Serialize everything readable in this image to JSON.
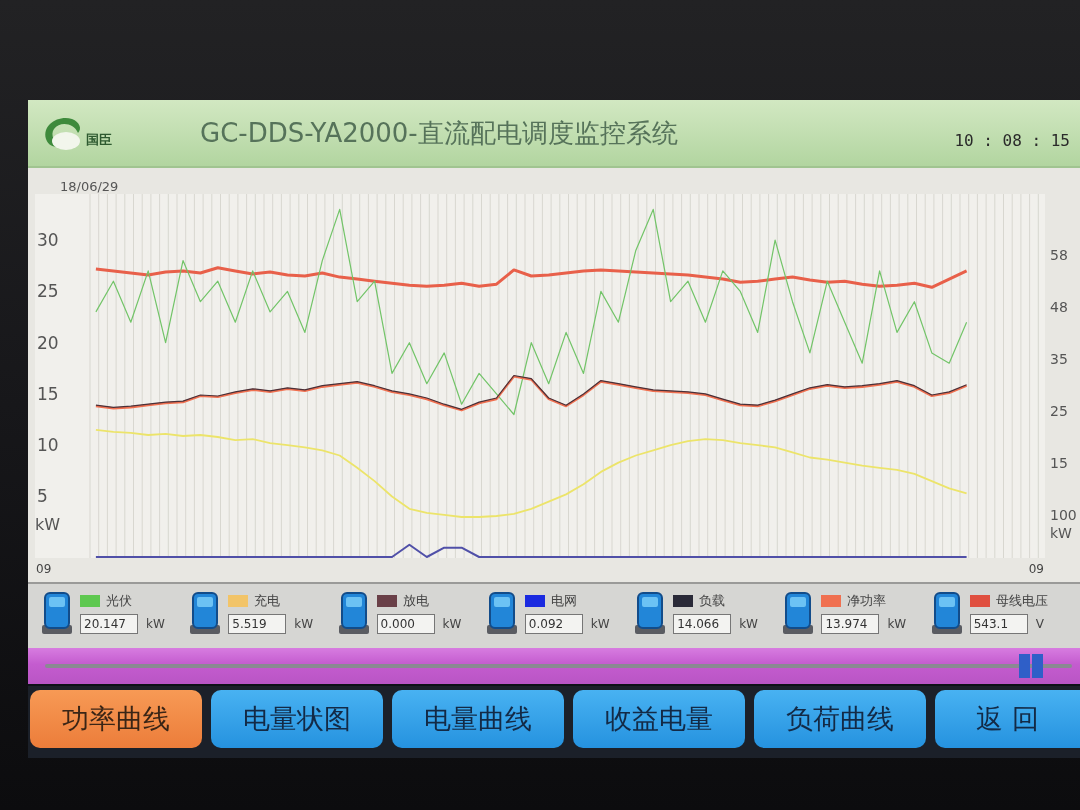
{
  "header": {
    "logo_text": "国臣",
    "title": "GC-DDS-YA2000-直流配电调度监控系统",
    "time": "10 : 08 : 15"
  },
  "chart": {
    "date": "18/06/29",
    "right_axis": {
      "labels": [
        "58",
        "48",
        "35",
        "25",
        "15",
        "100"
      ],
      "unit": "kW"
    },
    "chart_data": {
      "type": "line",
      "grid": true,
      "ylabel": "kW",
      "ylim": [
        -1,
        34.5
      ],
      "yticks": [
        5,
        10,
        15,
        20,
        25,
        30
      ],
      "categories": [
        "09",
        null,
        null,
        null,
        null,
        null,
        null,
        null,
        null,
        null,
        null,
        null,
        null,
        null,
        null,
        null,
        null,
        null,
        null,
        null,
        null,
        null,
        null,
        null,
        null,
        null,
        null,
        null,
        null,
        null,
        null,
        null,
        null,
        null,
        null,
        null,
        null,
        null,
        null,
        null,
        null,
        null,
        null,
        null,
        null,
        null,
        null,
        null,
        null,
        null,
        null,
        null,
        null,
        null,
        null,
        null,
        null,
        "09"
      ],
      "series": [
        {
          "color": "#e8604a",
          "values": [
            null,
            null,
            null,
            27.2,
            27.0,
            26.8,
            26.6,
            26.9,
            27.0,
            26.8,
            27.3,
            27.0,
            26.7,
            26.9,
            26.6,
            26.5,
            26.8,
            26.4,
            26.2,
            26.0,
            25.8,
            25.6,
            25.5,
            25.6,
            25.8,
            25.5,
            25.7,
            27.1,
            26.5,
            26.6,
            26.8,
            27.0,
            27.1,
            27.0,
            26.9,
            26.8,
            26.7,
            26.6,
            26.4,
            26.2,
            25.9,
            26.0,
            26.2,
            26.4,
            26.1,
            25.9,
            26.0,
            25.7,
            25.5,
            25.6,
            25.8,
            25.4,
            26.2,
            27.0,
            null,
            null,
            null,
            null
          ]
        },
        {
          "color": "#72c468",
          "values": [
            null,
            null,
            null,
            23,
            26,
            22,
            27,
            20,
            28,
            24,
            26,
            22,
            27,
            23,
            25,
            21,
            28,
            33,
            24,
            26,
            17,
            20,
            16,
            19,
            14,
            17,
            15,
            13,
            20,
            16,
            21,
            17,
            25,
            22,
            29,
            33,
            24,
            26,
            22,
            27,
            25,
            21,
            30,
            24,
            19,
            26,
            22,
            18,
            27,
            21,
            24,
            19,
            18,
            22,
            null,
            null,
            null,
            null
          ]
        },
        {
          "color": "#f07050",
          "values": [
            null,
            null,
            null,
            13.8,
            13.6,
            13.7,
            13.9,
            14.1,
            14.2,
            14.8,
            14.7,
            15.1,
            15.4,
            15.2,
            15.5,
            15.3,
            15.7,
            15.9,
            16.1,
            15.7,
            15.2,
            14.9,
            14.5,
            13.9,
            13.4,
            14.1,
            14.5,
            16.7,
            16.4,
            14.5,
            13.8,
            14.9,
            16.2,
            15.9,
            15.6,
            15.3,
            15.2,
            15.1,
            14.9,
            14.4,
            13.9,
            13.8,
            14.3,
            14.9,
            15.5,
            15.8,
            15.6,
            15.7,
            15.9,
            16.2,
            15.7,
            14.8,
            15.1,
            15.8,
            null,
            null,
            null,
            null
          ]
        },
        {
          "color": "#4a3038",
          "values": [
            null,
            null,
            null,
            13.9,
            13.7,
            13.8,
            14.0,
            14.2,
            14.3,
            14.9,
            14.8,
            15.2,
            15.5,
            15.3,
            15.6,
            15.4,
            15.8,
            16.0,
            16.2,
            15.8,
            15.3,
            15.0,
            14.6,
            14.0,
            13.5,
            14.2,
            14.6,
            16.8,
            16.5,
            14.6,
            13.9,
            15.0,
            16.3,
            16.0,
            15.7,
            15.4,
            15.3,
            15.2,
            15.0,
            14.5,
            14.0,
            13.9,
            14.4,
            15.0,
            15.6,
            15.9,
            15.7,
            15.8,
            16.0,
            16.3,
            15.8,
            14.9,
            15.2,
            15.9,
            null,
            null,
            null,
            null
          ]
        },
        {
          "color": "#ece46a",
          "values": [
            null,
            null,
            null,
            11.5,
            11.3,
            11.2,
            11.0,
            11.1,
            10.9,
            11.0,
            10.8,
            10.5,
            10.6,
            10.2,
            10.0,
            9.8,
            9.5,
            9.0,
            7.8,
            6.5,
            5.0,
            3.8,
            3.4,
            3.2,
            3.0,
            3.0,
            3.1,
            3.3,
            3.8,
            4.5,
            5.2,
            6.2,
            7.4,
            8.3,
            9.0,
            9.5,
            10.0,
            10.4,
            10.6,
            10.5,
            10.2,
            10.0,
            9.8,
            9.3,
            8.8,
            8.6,
            8.3,
            8.0,
            7.8,
            7.6,
            7.2,
            6.5,
            5.8,
            5.3,
            null,
            null,
            null,
            null
          ]
        },
        {
          "color": "#5050a8",
          "values": [
            null,
            null,
            null,
            -0.9,
            -0.9,
            -0.9,
            -0.9,
            -0.9,
            -0.9,
            -0.9,
            -0.9,
            -0.9,
            -0.9,
            -0.9,
            -0.9,
            -0.9,
            -0.9,
            -0.9,
            -0.9,
            -0.9,
            -0.9,
            0.3,
            -0.9,
            0.0,
            0.0,
            -0.9,
            -0.9,
            -0.9,
            -0.9,
            -0.9,
            -0.9,
            -0.9,
            -0.9,
            -0.9,
            -0.9,
            -0.9,
            -0.9,
            -0.9,
            -0.9,
            -0.9,
            -0.9,
            -0.9,
            -0.9,
            -0.9,
            -0.9,
            -0.9,
            -0.9,
            -0.9,
            -0.9,
            -0.9,
            -0.9,
            -0.9,
            -0.9,
            -0.9,
            null,
            null,
            null,
            null
          ]
        }
      ]
    }
  },
  "legend": [
    {
      "label": "光伏",
      "color": "#5ec850",
      "value": "20.147",
      "unit": "kW"
    },
    {
      "label": "充电",
      "color": "#f2c468",
      "value": "5.519",
      "unit": "kW"
    },
    {
      "label": "放电",
      "color": "#6a4048",
      "value": "0.000",
      "unit": "kW"
    },
    {
      "label": "电网",
      "color": "#1a2ae0",
      "value": "0.092",
      "unit": "kW"
    },
    {
      "label": "负载",
      "color": "#2a2a38",
      "value": "14.066",
      "unit": "kW"
    },
    {
      "label": "净功率",
      "color": "#f07050",
      "value": "13.974",
      "unit": "kW"
    },
    {
      "label": "母线电压",
      "color": "#e05040",
      "value": "543.1",
      "unit": "V"
    }
  ],
  "slider": {
    "level": 0.96
  },
  "buttons": [
    {
      "label": "功率曲线",
      "selected": true
    },
    {
      "label": "电量状图",
      "selected": false
    },
    {
      "label": "电量曲线",
      "selected": false
    },
    {
      "label": "收益电量",
      "selected": false
    },
    {
      "label": "负荷曲线",
      "selected": false
    },
    {
      "label": "返 回",
      "selected": false
    }
  ]
}
